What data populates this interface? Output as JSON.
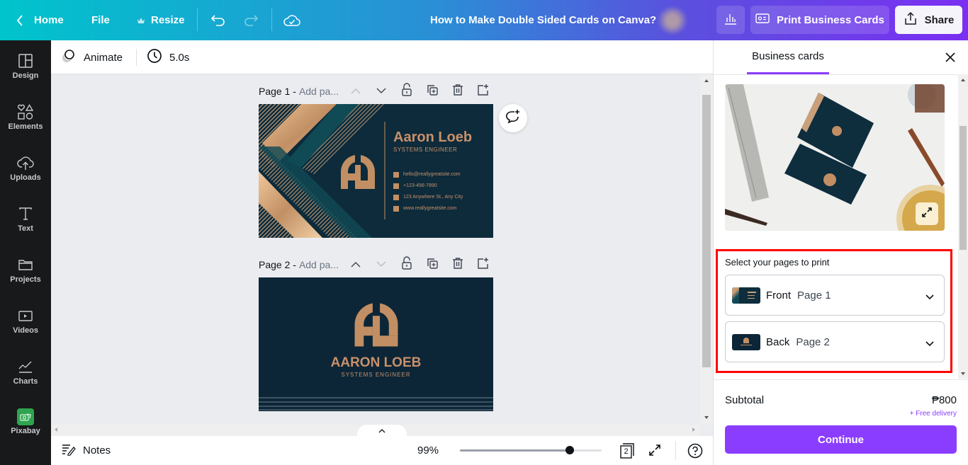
{
  "header": {
    "home_label": "Home",
    "file_label": "File",
    "resize_label": "Resize",
    "doc_title": "How to Make Double Sided Cards on Canva?",
    "print_label": "Print Business Cards",
    "share_label": "Share",
    "icons": [
      "chevron-left-icon",
      "crown-icon",
      "undo-icon",
      "redo-icon",
      "cloud-check-icon",
      "analytics-icon",
      "id-card-icon",
      "share-upload-icon"
    ]
  },
  "sidebar": {
    "items": [
      {
        "label": "Design",
        "icon": "layout-icon"
      },
      {
        "label": "Elements",
        "icon": "shapes-icon"
      },
      {
        "label": "Uploads",
        "icon": "cloud-upload-icon"
      },
      {
        "label": "Text",
        "icon": "text-icon"
      },
      {
        "label": "Projects",
        "icon": "folder-icon"
      },
      {
        "label": "Videos",
        "icon": "video-icon"
      },
      {
        "label": "Charts",
        "icon": "chart-line-icon"
      },
      {
        "label": "Pixabay",
        "icon": "pixabay-icon"
      }
    ],
    "pixabay_color": "#2ea44f"
  },
  "toolbar": {
    "animate_label": "Animate",
    "duration_label": "5.0s"
  },
  "pages": [
    {
      "title": "Page 1 -",
      "add_title": "Add pa...",
      "up_enabled": false,
      "down_enabled": true
    },
    {
      "title": "Page 2 -",
      "add_title": "Add pa...",
      "up_enabled": true,
      "down_enabled": false
    }
  ],
  "card_front": {
    "name": "Aaron Loeb",
    "role": "SYSTEMS ENGINEER",
    "email": "hello@reallygreatsite.com",
    "phone": "+123-456-7890",
    "address": "123 Anywhere St., Any City",
    "website": "www.reallygreatsite.com"
  },
  "card_back": {
    "name": "AARON LOEB",
    "role": "SYSTEMS ENGINEER"
  },
  "bottom": {
    "notes_label": "Notes",
    "zoom_label": "99%",
    "zoom_percent": 99,
    "page_count": "2"
  },
  "panel": {
    "tab_label": "Business cards",
    "select_heading": "Select your pages to print",
    "selections": [
      {
        "side": "Front",
        "page": "Page 1"
      },
      {
        "side": "Back",
        "page": "Page 2"
      }
    ],
    "subtotal_label": "Subtotal",
    "subtotal_value": "₱800",
    "delivery_label": "+ Free delivery",
    "continue_label": "Continue",
    "accent_color": "#8b3dff",
    "highlight_color": "#ff0000"
  }
}
